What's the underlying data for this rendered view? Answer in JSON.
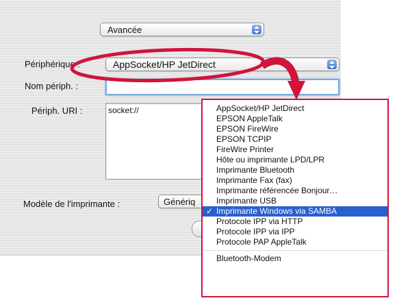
{
  "top_popup": {
    "value": "Avancée"
  },
  "form": {
    "device_label": "Périphérique :",
    "device_value": "AppSocket/HP JetDirect",
    "name_label": "Nom périph. :",
    "name_value": "",
    "uri_label": "Périph. URI :",
    "uri_value": "socket://",
    "model_label": "Modèle de l'imprimante :",
    "model_value": "Génériq"
  },
  "menu": {
    "items": [
      {
        "label": "AppSocket/HP JetDirect",
        "selected": false
      },
      {
        "label": "EPSON AppleTalk",
        "selected": false
      },
      {
        "label": "EPSON FireWire",
        "selected": false
      },
      {
        "label": "EPSON TCPIP",
        "selected": false
      },
      {
        "label": "FireWire Printer",
        "selected": false
      },
      {
        "label": "Hôte ou imprimante LPD/LPR",
        "selected": false
      },
      {
        "label": "Imprimante Bluetooth",
        "selected": false
      },
      {
        "label": "Imprimante Fax (fax)",
        "selected": false
      },
      {
        "label": "Imprimante référencée Bonjour…",
        "selected": false
      },
      {
        "label": "Imprimante USB",
        "selected": false
      },
      {
        "label": "Imprimante Windows via SAMBA",
        "selected": true,
        "check": "✓"
      },
      {
        "label": "Protocole IPP via HTTP",
        "selected": false
      },
      {
        "label": "Protocole IPP via IPP",
        "selected": false
      },
      {
        "label": "Protocole PAP AppleTalk",
        "selected": false
      }
    ],
    "extra_item": {
      "label": "Bluetooth-Modem"
    }
  },
  "colors": {
    "callout": "#d0143c",
    "selection": "#2a5fd0",
    "popup_arrow": "#3a78d0"
  }
}
